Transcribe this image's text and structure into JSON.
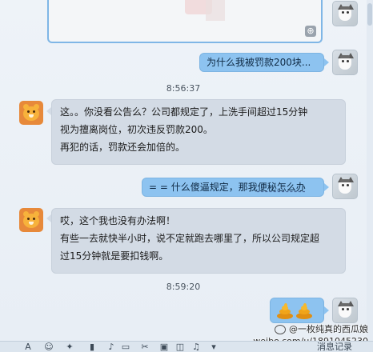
{
  "messages": {
    "m1": "为什么我被罚款200块...",
    "time1": "8:56:37",
    "m2_line1": "这。。你没看公告么？公司都规定了，上洗手间超过15分钟",
    "m2_line2": "视为擅离岗位，初次违反罚款200。",
    "m2_line3": "再犯的话，罚款还会加倍的。",
    "m3_prefix": "= = 什么傻逼规定，那我",
    "m3_underlined": "便秘怎么办",
    "m4_line1": "哎，这个我也没有办法啊！",
    "m4_line2": "有些一去就快半小时，说不定就跑去哪里了，所以公司规定超",
    "m4_line3": "过15分钟就是要扣钱啊。",
    "time2": "8:59:20"
  },
  "icons": {
    "zoom": "zoom-in-icon",
    "sticker": "poop-emoji-icon"
  },
  "watermark": {
    "name": "一枚纯真的西瓜娘",
    "url": "weibo.com/u/1891045230"
  },
  "toolbar": {
    "font_glyph": "A",
    "more_label": "消息记录"
  },
  "colors": {
    "outgoing_bubble": "#8dc3f0",
    "incoming_bubble": "#d3dbe5",
    "chat_background": "#eef3f8"
  }
}
